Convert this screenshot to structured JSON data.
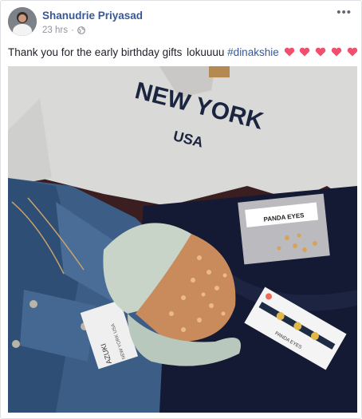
{
  "post": {
    "author": "Shanudrie Priyasad",
    "time": "23 hrs",
    "separator": "·",
    "privacy_icon": "globe-icon",
    "more_options": "•••",
    "caption": {
      "text_before": "Thank you for the early birthday gifts",
      "text_middle": " lokuuuu ",
      "hashtag": "#dinakshie",
      "heart_color": "#f0506e"
    }
  },
  "photo": {
    "shirt_text_line1": "NEW YORK",
    "shirt_text_line2": "USA",
    "tag_brand": "AZUKI",
    "tag_sub": "NEW YORK USA",
    "package_brand": "PANDA EYES",
    "package_brand_2": "PANDA EYES"
  }
}
